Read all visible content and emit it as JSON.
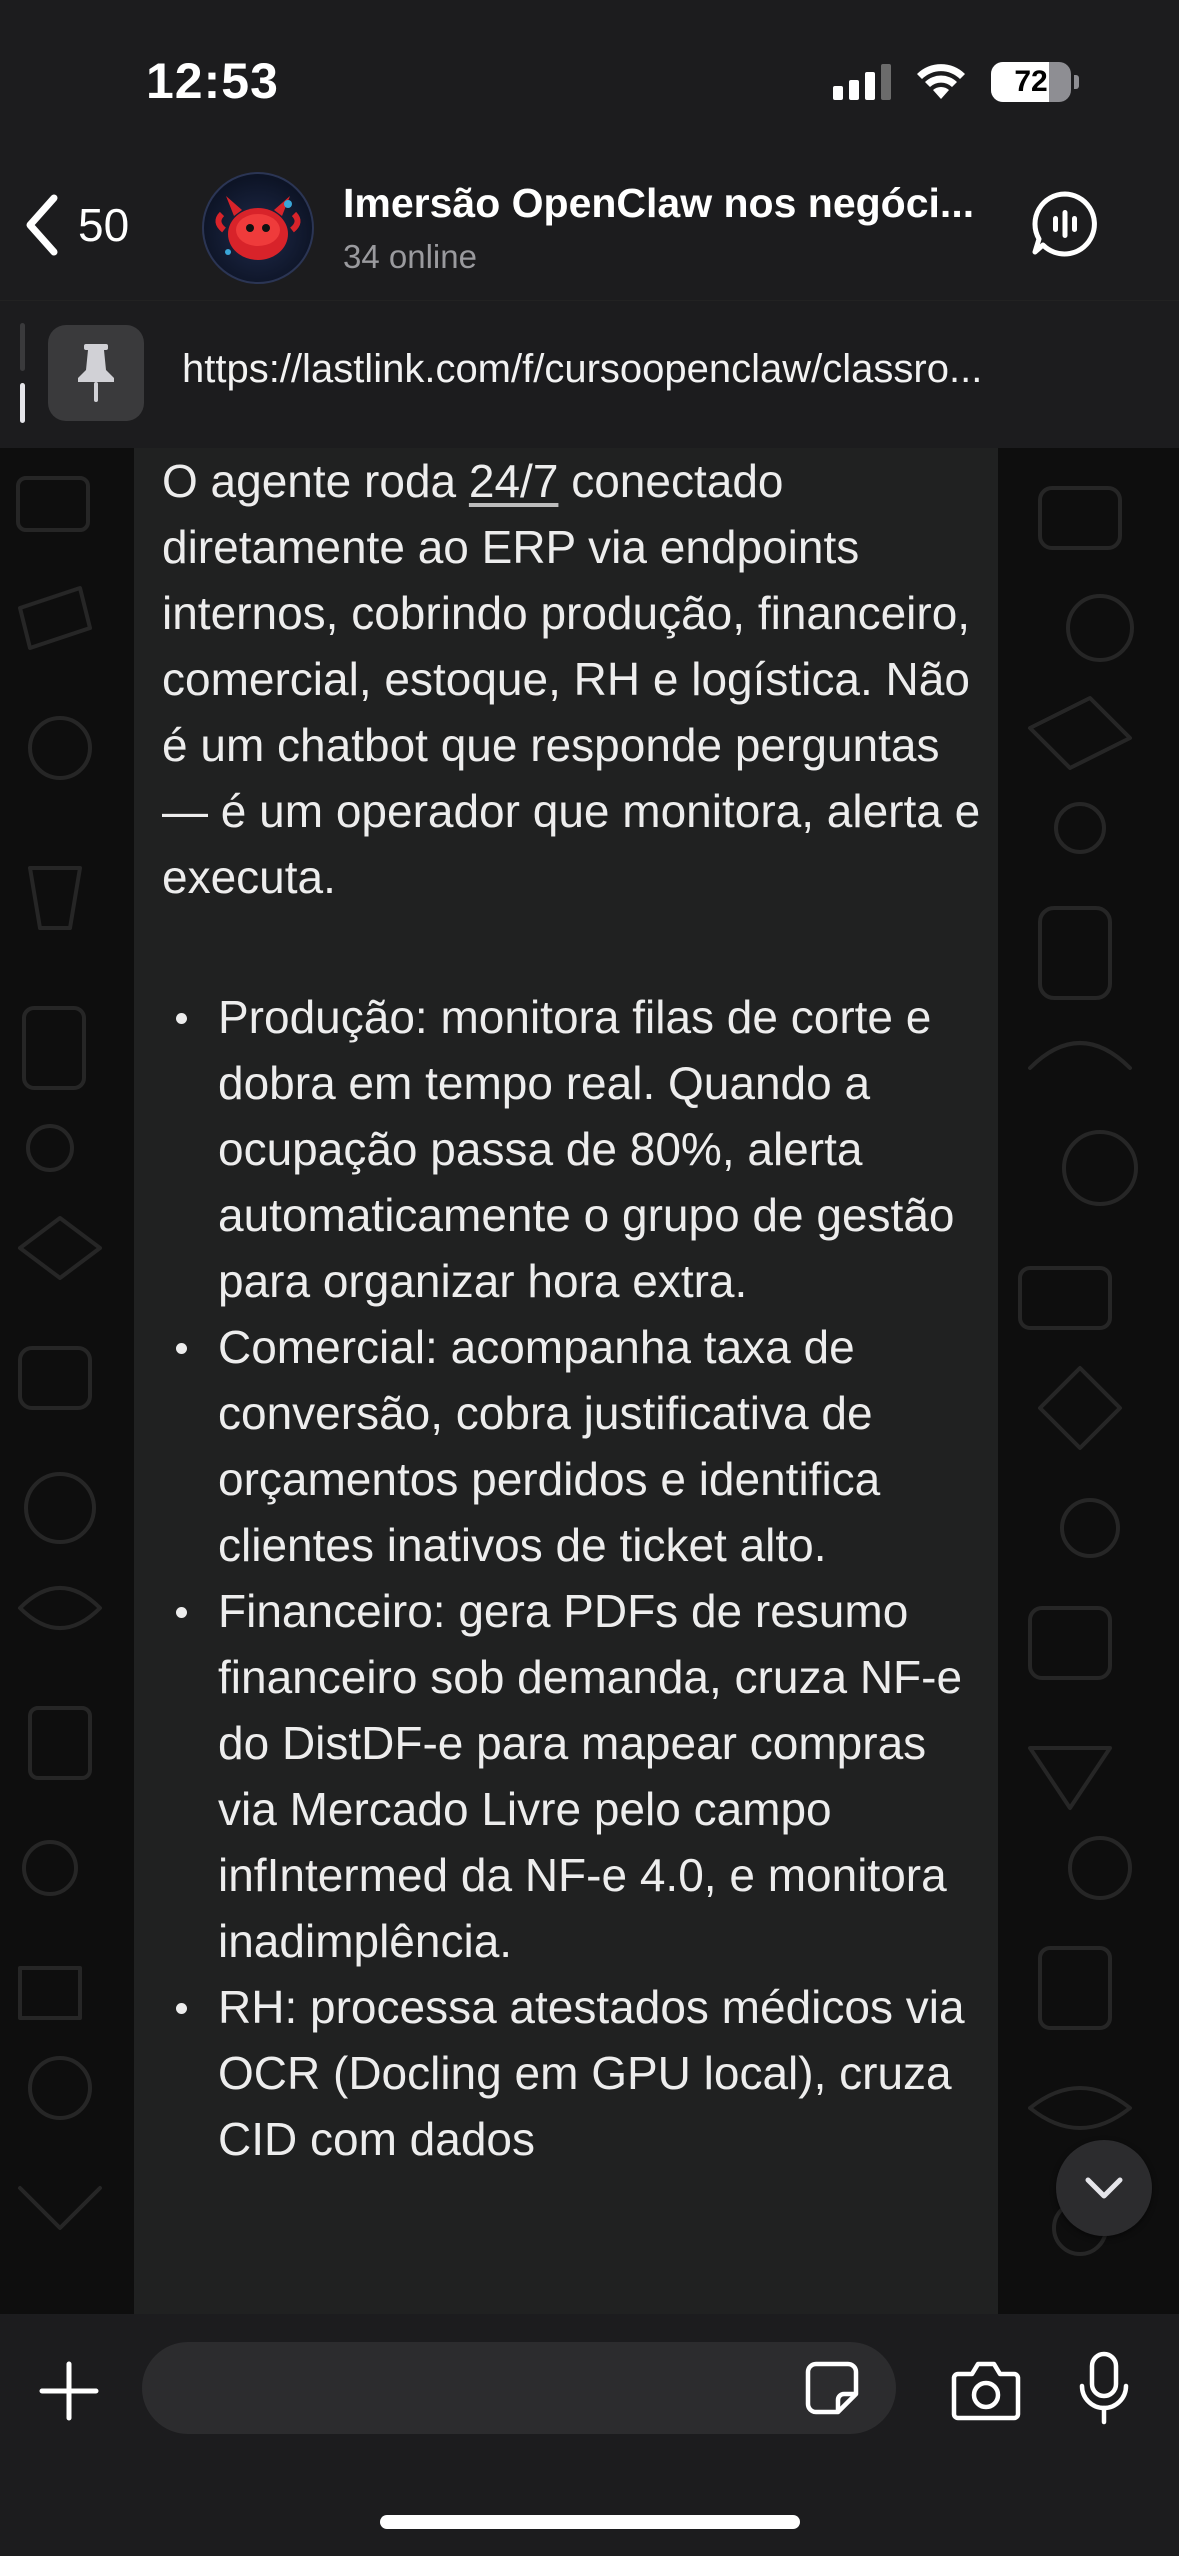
{
  "status_bar": {
    "time": "12:53",
    "battery": "72",
    "battery_level": 0.72
  },
  "header": {
    "back_count": "50",
    "title": "Imersão OpenClaw nos negóci...",
    "subtitle": "34 online",
    "avatar_icon": "red-creature-avatar",
    "call_icon": "voice-chat-icon"
  },
  "pinned": {
    "icon": "pin-icon",
    "text": "https://lastlink.com/f/cursoopenclaw/classro..."
  },
  "message": {
    "intro_before": "O agente roda ",
    "intro_link": "24/7",
    "intro_after": " conectado diretamente ao ERP via endpoints internos, cobrindo produção, financeiro, comercial, estoque, RH e logística. Não é um chatbot que responde perguntas — é um operador que monitora, alerta e executa.",
    "bullets": [
      "Produção: monitora filas de corte e dobra em tempo real. Quando a ocupação passa de 80%, alerta automaticamente o grupo de gestão para organizar hora extra.",
      "Comercial: acompanha taxa de conversão, cobra justificativa de orçamentos perdidos e identifica clientes inativos de ticket alto.",
      "Financeiro: gera PDFs de resumo financeiro sob demanda, cruza NF-e do DistDF-e para mapear compras via Mercado Livre pelo campo infIntermed da NF-e 4.0, e monitora inadimplência.",
      "RH: processa atestados médicos via OCR (Docling em GPU local), cruza CID com dados"
    ]
  },
  "input": {
    "placeholder": "",
    "value": ""
  },
  "colors": {
    "bar_bg": "#1c1c1e",
    "bubble_bg": "#202121",
    "chat_bg": "#0e0e0e",
    "text": "#ededed",
    "muted": "#9a9a9e"
  }
}
